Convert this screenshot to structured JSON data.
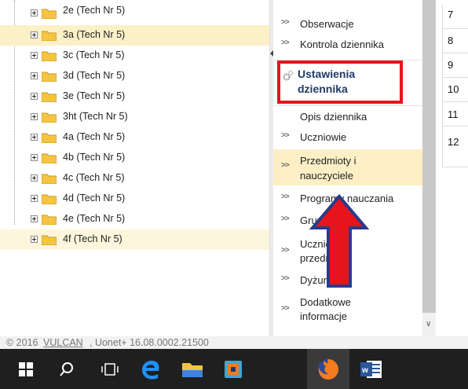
{
  "tree": {
    "items": [
      {
        "label": "2e (Tech Nr 5)",
        "selected": false
      },
      {
        "label": "3a (Tech Nr 5)",
        "selected": true
      },
      {
        "label": "3c (Tech Nr 5)",
        "selected": false
      },
      {
        "label": "3d (Tech Nr 5)",
        "selected": false
      },
      {
        "label": "3e (Tech Nr 5)",
        "selected": false
      },
      {
        "label": "3ht (Tech Nr 5)",
        "selected": false
      },
      {
        "label": "4a (Tech Nr 5)",
        "selected": false
      },
      {
        "label": "4b (Tech Nr 5)",
        "selected": false
      },
      {
        "label": "4c (Tech Nr 5)",
        "selected": false
      },
      {
        "label": "4d (Tech Nr 5)",
        "selected": false
      },
      {
        "label": "4e (Tech Nr 5)",
        "selected": false
      },
      {
        "label": "4f (Tech Nr 5)",
        "selected": false
      }
    ]
  },
  "menu": {
    "items": [
      {
        "label": "Obserwacje",
        "chevron": ">>"
      },
      {
        "label": "Kontrola dziennika",
        "chevron": ">>"
      },
      {
        "label": "Ustawienia dziennika",
        "chevron": "",
        "bold": true,
        "icon": "gears-icon"
      },
      {
        "label": "Opis dziennika",
        "chevron": ""
      },
      {
        "label": "Uczniowie",
        "chevron": ">>"
      },
      {
        "label": "Przedmioty i nauczyciele",
        "chevron": ">>",
        "highlighted": true
      },
      {
        "label": "Programy nauczania",
        "chevron": ">>"
      },
      {
        "label": "Grupy",
        "chevron": ">>"
      },
      {
        "label": "Uczniowie i przedmioty",
        "chevron": ">>"
      },
      {
        "label": "Dyżurni",
        "chevron": ">>"
      },
      {
        "label": "Dodatkowe informacje",
        "chevron": ">>"
      }
    ]
  },
  "numbers": [
    "7",
    "8",
    "9",
    "10",
    "11",
    "12"
  ],
  "footer": {
    "prefix": "© 2016 ",
    "company": "VULCAN",
    "suffix": ", Uonet+ 16.08.0002.21500"
  },
  "taskbar": {
    "icons": [
      "windows-start-icon",
      "search-icon",
      "task-view-icon",
      "edge-icon",
      "file-explorer-icon",
      "media-app-icon",
      "firefox-icon",
      "word-icon"
    ]
  },
  "colors": {
    "selection": "#fcf0c6",
    "annotation_red": "#e8141c",
    "folder": "#f5c542",
    "taskbar": "#1f1f1f"
  }
}
